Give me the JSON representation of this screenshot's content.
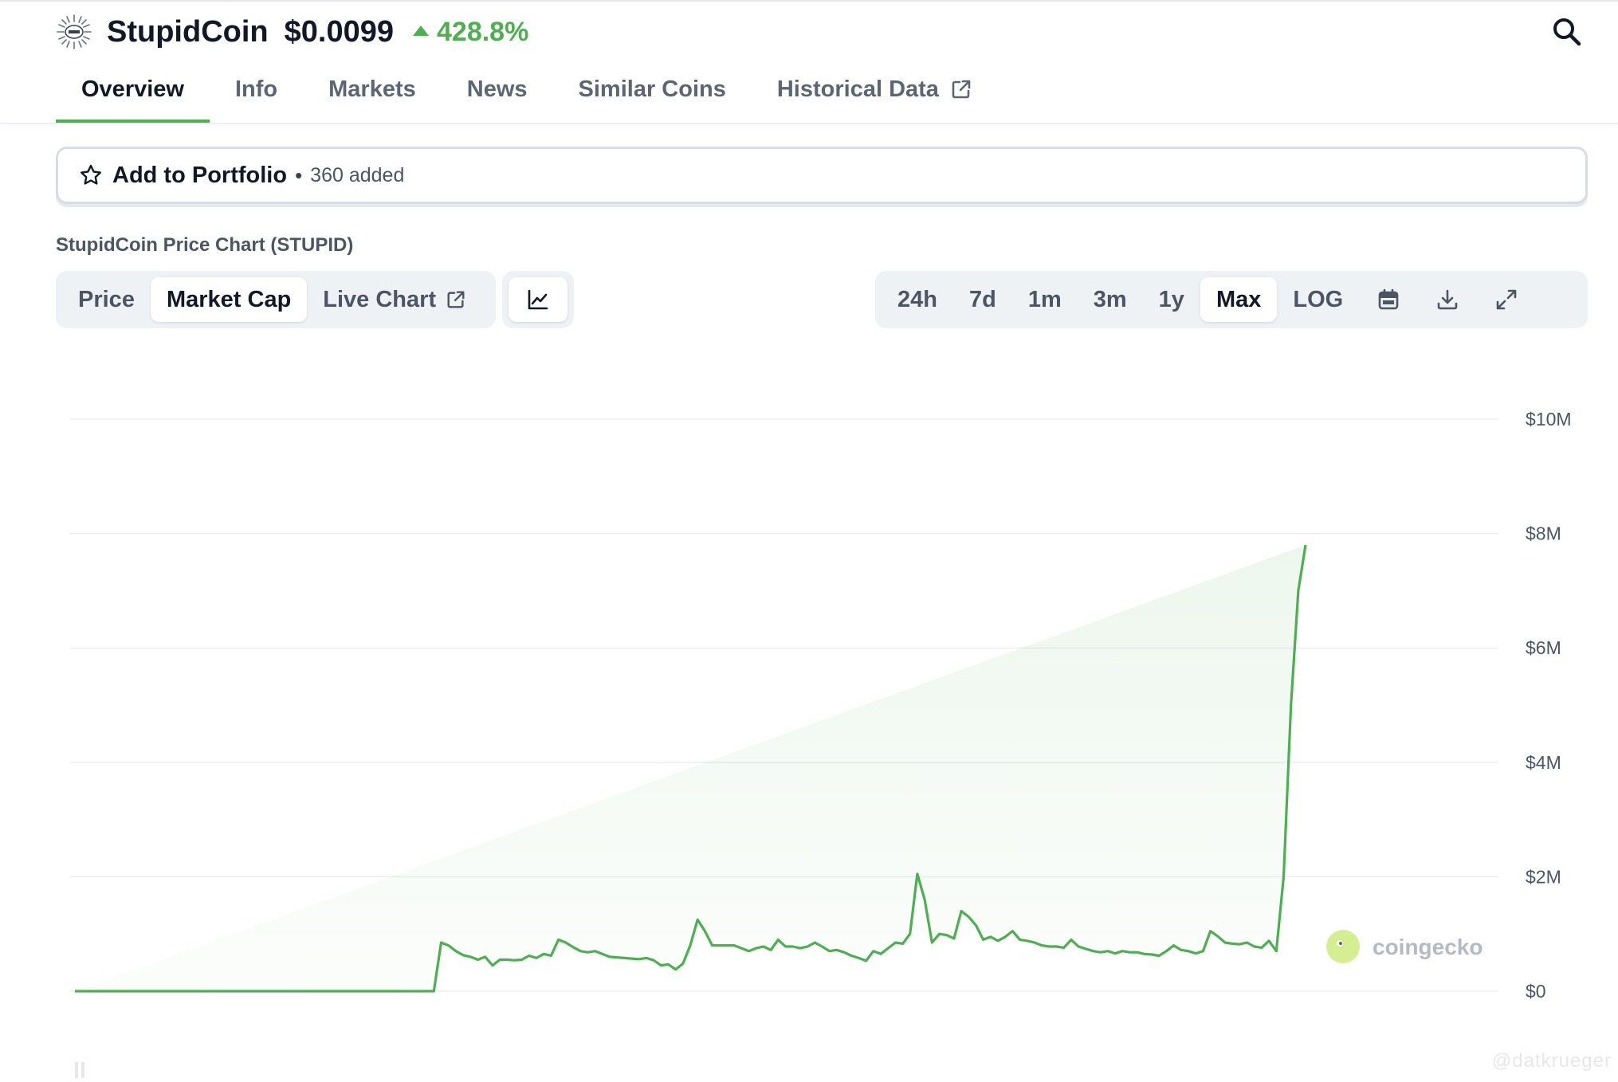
{
  "header": {
    "coin_name": "StupidCoin",
    "price": "$0.0099",
    "change": "428.8%",
    "change_direction": "up",
    "logo_icon": "sunburst-coin-logo-icon",
    "search_icon": "search-icon"
  },
  "tabs": [
    {
      "label": "Overview",
      "active": true
    },
    {
      "label": "Info",
      "active": false
    },
    {
      "label": "Markets",
      "active": false
    },
    {
      "label": "News",
      "active": false
    },
    {
      "label": "Similar Coins",
      "active": false
    },
    {
      "label": "Historical Data",
      "active": false,
      "icon": "external-link-icon"
    }
  ],
  "portfolio": {
    "label": "Add to Portfolio",
    "separator": "•",
    "count": "360 added",
    "icon": "star-icon"
  },
  "chart_title": "StupidCoin Price Chart (STUPID)",
  "chart_type_toggle": {
    "options": [
      {
        "label": "Price",
        "active": false
      },
      {
        "label": "Market Cap",
        "active": true
      },
      {
        "label": "Live Chart",
        "active": false,
        "icon": "external-link-icon"
      }
    ],
    "view_icon": "line-chart-icon"
  },
  "range_toggle": {
    "options": [
      {
        "label": "24h",
        "active": false
      },
      {
        "label": "7d",
        "active": false
      },
      {
        "label": "1m",
        "active": false
      },
      {
        "label": "3m",
        "active": false
      },
      {
        "label": "1y",
        "active": false
      },
      {
        "label": "Max",
        "active": true
      },
      {
        "label": "LOG",
        "active": false
      }
    ],
    "icons": [
      "calendar-icon",
      "download-icon",
      "expand-icon"
    ]
  },
  "chart_data": {
    "type": "area",
    "title": "",
    "xlabel": "",
    "ylabel": "",
    "ylim": [
      0,
      10000000
    ],
    "y_ticks": [
      "$10M",
      "$8M",
      "$6M",
      "$4M",
      "$2M",
      "$0"
    ],
    "y_tick_values": [
      10000000,
      8000000,
      6000000,
      4000000,
      2000000,
      0
    ],
    "grid": true,
    "line_color": "#4caf50",
    "x": [
      0,
      1,
      2,
      3,
      4,
      5,
      6,
      7,
      8,
      9,
      10,
      11,
      12,
      13,
      14,
      15,
      16,
      17,
      18,
      19,
      20,
      21,
      22,
      23,
      24,
      25,
      26,
      27,
      28,
      29,
      30,
      31,
      32,
      33,
      34,
      35,
      36,
      37,
      38,
      39,
      40,
      41,
      42,
      43,
      44,
      45,
      46,
      47,
      48,
      49,
      50,
      51,
      52,
      53,
      54,
      55,
      56,
      57,
      58,
      59,
      60,
      61,
      62,
      63,
      64,
      65,
      66,
      67,
      68,
      69,
      70,
      71,
      72,
      73,
      74,
      75,
      76,
      77,
      78,
      79,
      80,
      81,
      82,
      83,
      84,
      85,
      86,
      87,
      88,
      89,
      90,
      91,
      92,
      93,
      94,
      95,
      96,
      97,
      98,
      99,
      100,
      101,
      102,
      103,
      104,
      105,
      106,
      107,
      108,
      109,
      110,
      111,
      112,
      113,
      114,
      115,
      116,
      117,
      118,
      119,
      120,
      121,
      122,
      123,
      124,
      125,
      126,
      127,
      128,
      129,
      130,
      131,
      132,
      133,
      134,
      135,
      136,
      137,
      138,
      139,
      140,
      141,
      142,
      143,
      144,
      145,
      146,
      147,
      148,
      149,
      150,
      151,
      152,
      153,
      154,
      155,
      156,
      157,
      158,
      159,
      160,
      161,
      162,
      163,
      164,
      165,
      166,
      167,
      168,
      169,
      170,
      171,
      172,
      173,
      174,
      175,
      176,
      177,
      178,
      179,
      180,
      181,
      182,
      183,
      184,
      185,
      186,
      187,
      188,
      189,
      190,
      191,
      192,
      193,
      194
    ],
    "values": [
      0,
      0,
      0,
      0,
      0,
      0,
      0,
      0,
      0,
      0,
      0,
      0,
      0,
      0,
      0,
      0,
      0,
      0,
      0,
      0,
      0,
      0,
      0,
      0,
      0,
      0,
      0,
      0,
      0,
      0,
      0,
      0,
      0,
      0,
      0,
      0,
      0,
      0,
      0,
      0,
      0,
      0,
      0,
      0,
      0,
      0,
      0,
      0,
      0,
      0,
      850000,
      800000,
      700000,
      630000,
      600000,
      550000,
      600000,
      450000,
      550000,
      550000,
      540000,
      550000,
      620000,
      580000,
      650000,
      620000,
      900000,
      850000,
      770000,
      700000,
      680000,
      700000,
      650000,
      600000,
      590000,
      580000,
      570000,
      560000,
      580000,
      540000,
      450000,
      470000,
      380000,
      480000,
      800000,
      1250000,
      1050000,
      800000,
      800000,
      800000,
      800000,
      750000,
      700000,
      750000,
      780000,
      720000,
      900000,
      780000,
      780000,
      750000,
      780000,
      850000,
      780000,
      700000,
      720000,
      680000,
      620000,
      580000,
      530000,
      700000,
      650000,
      750000,
      850000,
      830000,
      1000000,
      2050000,
      1600000,
      850000,
      1000000,
      980000,
      920000,
      1400000,
      1300000,
      1150000,
      900000,
      950000,
      880000,
      950000,
      1050000,
      900000,
      880000,
      850000,
      800000,
      780000,
      780000,
      760000,
      900000,
      780000,
      740000,
      700000,
      680000,
      700000,
      660000,
      700000,
      680000,
      680000,
      650000,
      640000,
      620000,
      700000,
      800000,
      720000,
      700000,
      660000,
      700000,
      1050000,
      960000,
      850000,
      830000,
      820000,
      850000,
      780000,
      760000,
      880000,
      700000,
      2000000,
      5000000,
      7000000,
      7800000
    ]
  },
  "watermark": "coingecko",
  "credit": "@datkrueger"
}
